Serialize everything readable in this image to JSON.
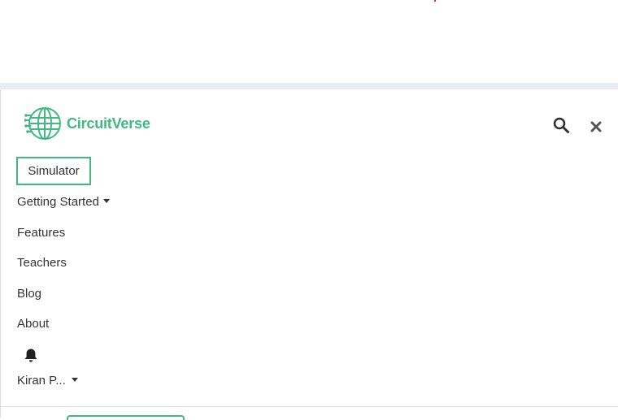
{
  "brand": {
    "name": "CircuitVerse",
    "color": "#42b983"
  },
  "header": {
    "search_icon": "search-icon",
    "close_icon": "close-icon"
  },
  "menu": {
    "simulator": "Simulator",
    "getting_started": "Getting Started",
    "features": "Features",
    "teachers": "Teachers",
    "blog": "Blog",
    "about": "About",
    "notification_icon": "bell-icon",
    "user": "Kiran P..."
  }
}
